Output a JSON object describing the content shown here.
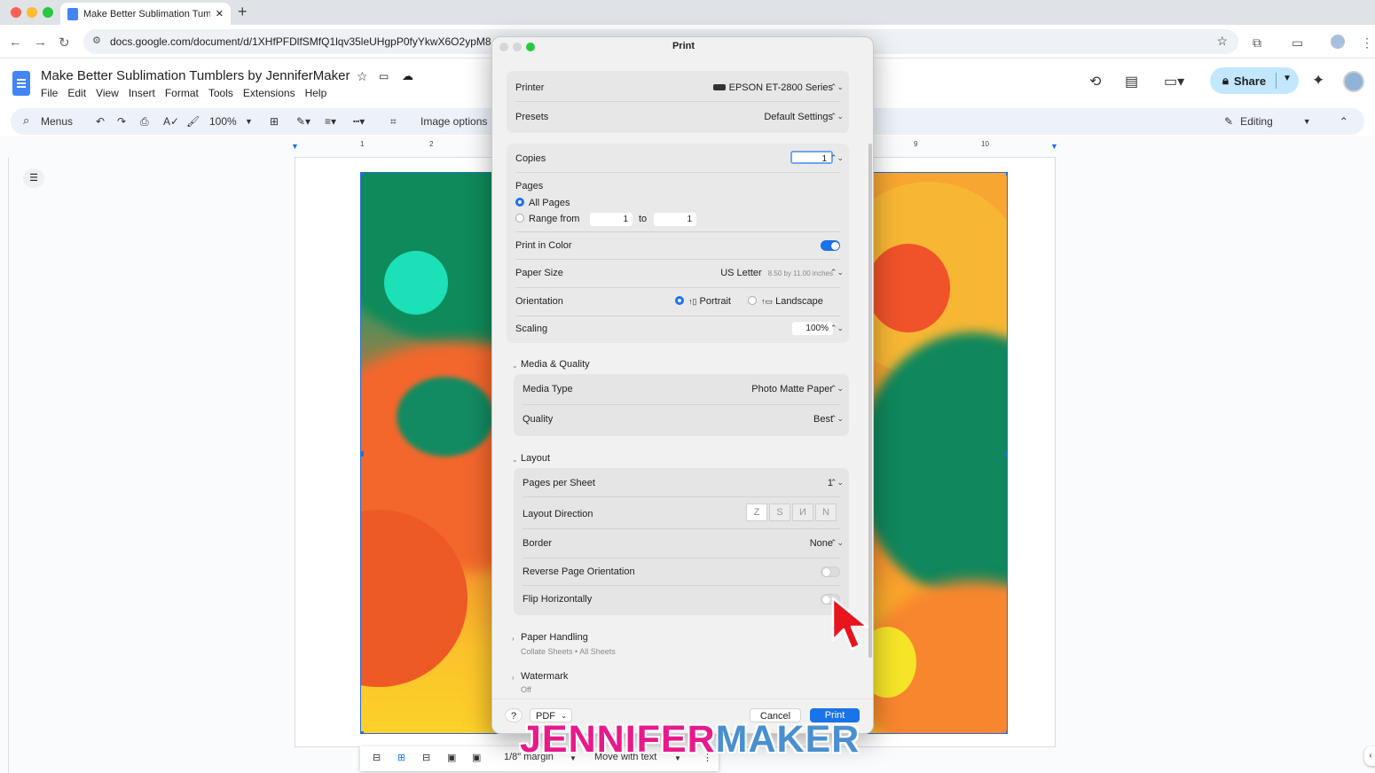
{
  "browser": {
    "tab_title": "Make Better Sublimation Tum",
    "address": "docs.google.com/document/d/1XHfPFDlfSMfQ1lqv35leUHgpP0fyYkwX6O2ypM8"
  },
  "docs": {
    "title": "Make Better Sublimation Tumblers by JenniferMaker",
    "menus": [
      "File",
      "Edit",
      "View",
      "Insert",
      "Format",
      "Tools",
      "Extensions",
      "Help"
    ],
    "share_label": "Share",
    "mode_label": "Editing",
    "toolbar": {
      "search_label": "Menus",
      "zoom": "100%",
      "image_options": "Image options"
    },
    "ruler_marks": [
      "1",
      "2",
      "9",
      "10"
    ],
    "image_toolbar": {
      "margin": "1/8\" margin",
      "wrap": "Move with text"
    }
  },
  "print_dialog": {
    "title": "Print",
    "printer_label": "Printer",
    "printer_value": "EPSON ET-2800 Series",
    "presets_label": "Presets",
    "presets_value": "Default Settings",
    "copies_label": "Copies",
    "copies_value": "1",
    "pages_label": "Pages",
    "all_pages_label": "All Pages",
    "range_label": "Range from",
    "range_from": "1",
    "range_to_label": "to",
    "range_to": "1",
    "color_label": "Print in Color",
    "print_in_color": true,
    "paper_size_label": "Paper Size",
    "paper_size_value": "US Letter",
    "paper_size_dims": "8.50 by 11.00 inches",
    "orientation_label": "Orientation",
    "portrait_label": "Portrait",
    "landscape_label": "Landscape",
    "scaling_label": "Scaling",
    "scaling_value": "100%",
    "media_group": "Media & Quality",
    "media_type_label": "Media Type",
    "media_type_value": "Photo Matte Paper",
    "quality_label": "Quality",
    "quality_value": "Best",
    "layout_group": "Layout",
    "pps_label": "Pages per Sheet",
    "pps_value": "1",
    "layout_dir_label": "Layout Direction",
    "border_label": "Border",
    "border_value": "None",
    "reverse_label": "Reverse Page Orientation",
    "reverse_on": false,
    "flip_label": "Flip Horizontally",
    "flip_on": false,
    "paper_handling_group": "Paper Handling",
    "paper_handling_sub": "Collate Sheets • All Sheets",
    "watermark_group": "Watermark",
    "watermark_sub": "Off",
    "help_label": "?",
    "pdf_label": "PDF",
    "cancel_label": "Cancel",
    "print_label": "Print"
  },
  "branding": {
    "logo_part1": "JENNIFER",
    "logo_part2": "MAKER"
  },
  "colors": {
    "accent": "#1a73e8",
    "share_bg": "#c2e7ff",
    "logo_pink": "#e8198b",
    "logo_blue": "#4a8fcf",
    "cursor": "#e8141e"
  }
}
